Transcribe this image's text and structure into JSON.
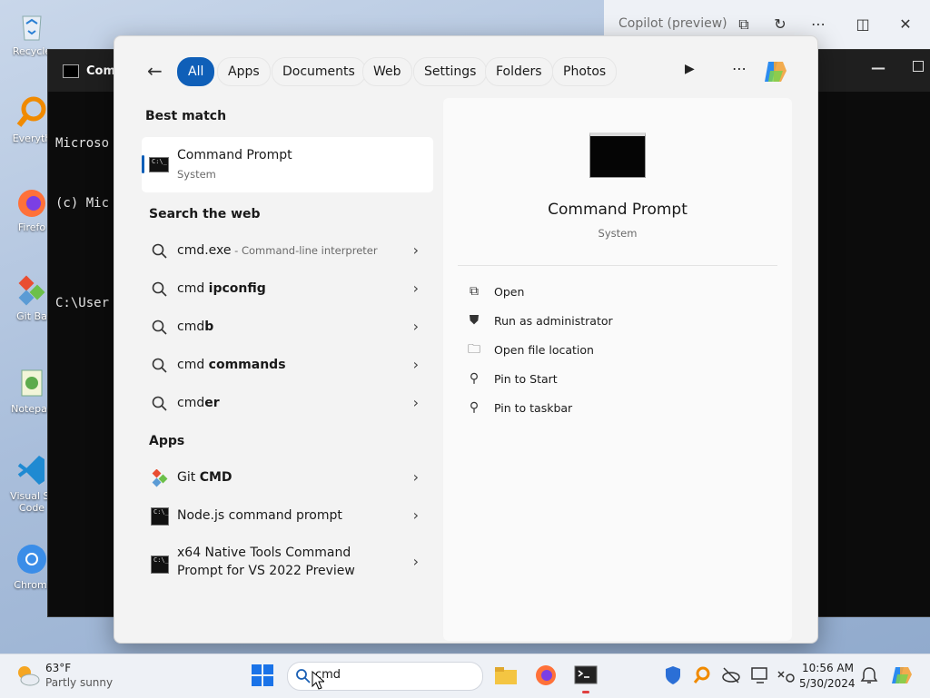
{
  "desktop": {
    "icons": [
      {
        "label": "Recycle",
        "icon": "recycle-bin-icon"
      },
      {
        "label": "Everyth",
        "icon": "everything-search-icon"
      },
      {
        "label": "Firefo",
        "icon": "firefox-icon"
      },
      {
        "label": "Git Ba",
        "icon": "git-bash-icon"
      },
      {
        "label": "Notepac",
        "icon": "notepad-icon"
      },
      {
        "label": "Visual St",
        "label2": "Code",
        "icon": "vscode-icon"
      },
      {
        "label": "Chromi",
        "icon": "chromium-icon"
      }
    ]
  },
  "console_window": {
    "title": "Comn",
    "lines": [
      "Microso",
      "(c) Mic",
      "",
      "C:\\User"
    ]
  },
  "copilot": {
    "title": "Copilot (preview)"
  },
  "search_panel": {
    "filters": [
      "All",
      "Apps",
      "Documents",
      "Web",
      "Settings",
      "Folders",
      "Photos"
    ],
    "best_match_heading": "Best match",
    "best_match": {
      "name": "Command Prompt",
      "type": "System"
    },
    "web_heading": "Search the web",
    "web_results": [
      {
        "query": "cmd.exe",
        "desc": " - Command-line interpreter"
      },
      {
        "prefix": "cmd ",
        "bold": "ipconfig"
      },
      {
        "prefix": "cmd",
        "bold": "b"
      },
      {
        "prefix": "cmd ",
        "bold": "commands"
      },
      {
        "prefix": "cmd",
        "bold": "er"
      }
    ],
    "apps_heading": "Apps",
    "apps": [
      {
        "prefix": "Git ",
        "bold": "CMD",
        "icon": "git-cmd-icon"
      },
      {
        "name": "Node.js command prompt",
        "icon": "command-prompt-icon"
      },
      {
        "line1": "x64 Native Tools Command",
        "line2": "Prompt for VS 2022 Preview",
        "icon": "command-prompt-icon"
      }
    ],
    "preview": {
      "name": "Command Prompt",
      "type": "System",
      "actions": [
        {
          "label": "Open",
          "icon": "open-icon"
        },
        {
          "label": "Run as administrator",
          "icon": "shield-admin-icon"
        },
        {
          "label": "Open file location",
          "icon": "folder-icon"
        },
        {
          "label": "Pin to Start",
          "icon": "pin-icon"
        },
        {
          "label": "Pin to taskbar",
          "icon": "pin-icon"
        }
      ]
    }
  },
  "taskbar": {
    "weather_temp": "63°F",
    "weather_desc": "Partly sunny",
    "search_value": "cmd",
    "time": "10:56 AM",
    "date": "5/30/2024"
  },
  "colors": {
    "accent": "#0f5fb8",
    "panel_bg": "#f3f3f3"
  }
}
